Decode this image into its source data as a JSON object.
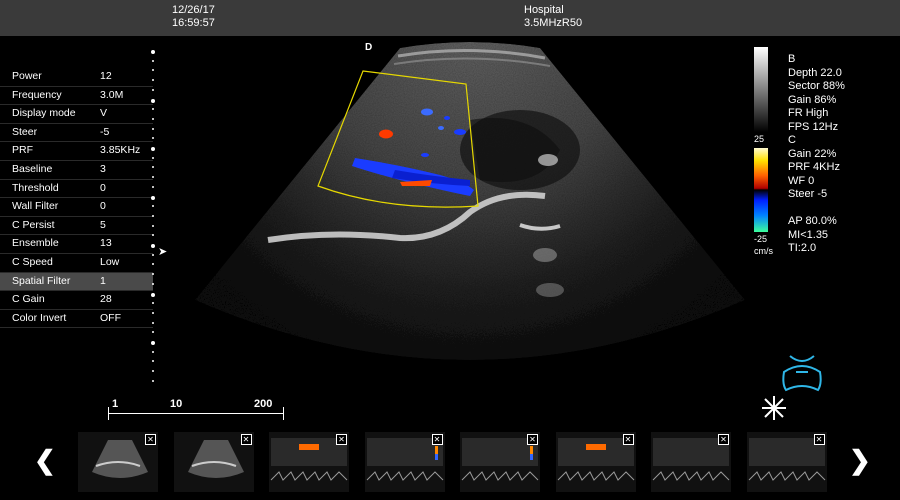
{
  "header": {
    "date": "12/26/17",
    "time": "16:59:57",
    "hospital": "Hospital",
    "probe": "3.5MHzR50"
  },
  "orientation_marker": "D",
  "params": [
    {
      "label": "Power",
      "value": "12"
    },
    {
      "label": "Frequency",
      "value": "3.0M"
    },
    {
      "label": "Display mode",
      "value": "V"
    },
    {
      "label": "Steer",
      "value": "-5"
    },
    {
      "label": "PRF",
      "value": "3.85KHz"
    },
    {
      "label": "Baseline",
      "value": "3"
    },
    {
      "label": "Threshold",
      "value": "0"
    },
    {
      "label": "Wall Filter",
      "value": "0"
    },
    {
      "label": "C Persist",
      "value": "5"
    },
    {
      "label": "Ensemble",
      "value": "13"
    },
    {
      "label": "C Speed",
      "value": "Low"
    },
    {
      "label": "Spatial Filter",
      "value": "1",
      "selected": true
    },
    {
      "label": "C Gain",
      "value": "28"
    },
    {
      "label": "Color Invert",
      "value": "OFF"
    }
  ],
  "info_b": {
    "mode": "B",
    "depth": "Depth 22.0",
    "sector": "Sector 88%",
    "gain": "Gain 86%",
    "fr": "FR High",
    "fps": "FPS 12Hz"
  },
  "colorbar": {
    "top": "25",
    "bottom": "-25",
    "unit": "cm/s"
  },
  "info_c": {
    "mode": "C",
    "gain": "Gain  22%",
    "prf": "PRF 4KHz",
    "wf": "WF 0",
    "steer": "Steer -5",
    "ap": "AP 80.0%",
    "mi": "MI<1.35",
    "ti": "TI:2.0"
  },
  "scale": {
    "t1": "1",
    "t2": "10",
    "t3": "200"
  },
  "thumbnails_count": 8,
  "icons": {
    "prev": "chevron-left-icon",
    "next": "chevron-right-icon",
    "freeze": "snowflake-icon",
    "body_marker": "probe-body-marker-icon",
    "close": "close-icon"
  },
  "colors": {
    "roi": "#e6d800",
    "flow_blue": "#1a3cff",
    "flow_red": "#ff3a00",
    "topbar": "#3a3a3a"
  }
}
